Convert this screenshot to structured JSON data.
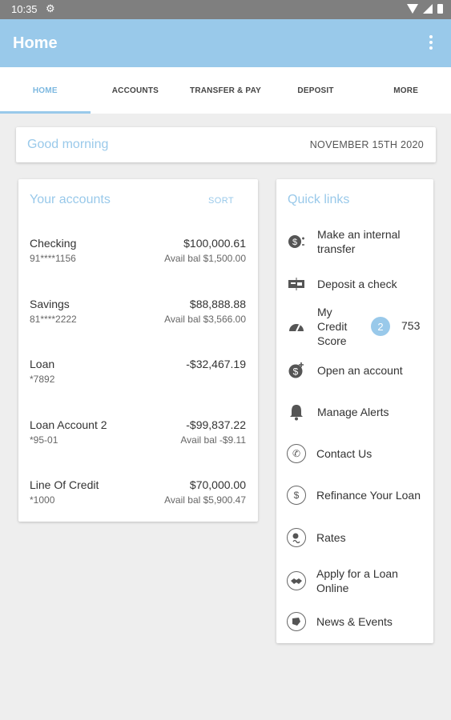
{
  "status_bar": {
    "time": "10:35"
  },
  "app_bar": {
    "title": "Home"
  },
  "tabs": [
    {
      "label": "HOME",
      "active": true
    },
    {
      "label": "ACCOUNTS",
      "active": false
    },
    {
      "label": "TRANSFER & PAY",
      "active": false
    },
    {
      "label": "DEPOSIT",
      "active": false
    },
    {
      "label": "MORE",
      "active": false
    }
  ],
  "greeting": {
    "text": "Good morning",
    "date": "NOVEMBER 15TH 2020"
  },
  "accounts": {
    "title": "Your accounts",
    "sort_label": "SORT",
    "items": [
      {
        "name": "Checking",
        "number": "91****1156",
        "amount": "$100,000.61",
        "avail": "Avail bal $1,500.00"
      },
      {
        "name": "Savings",
        "number": "81****2222",
        "amount": "$88,888.88",
        "avail": "Avail bal $3,566.00"
      },
      {
        "name": "Loan",
        "number": "*7892",
        "amount": "-$32,467.19",
        "avail": ""
      },
      {
        "name": "Loan Account 2",
        "number": "*95-01",
        "amount": "-$99,837.22",
        "avail": "Avail bal -$9.11"
      },
      {
        "name": "Line Of Credit",
        "number": "*1000",
        "amount": "$70,000.00",
        "avail": "Avail bal $5,900.47"
      }
    ]
  },
  "quick_links": {
    "title": "Quick links",
    "items": [
      {
        "label": "Make an internal transfer",
        "icon": "transfer-money-icon"
      },
      {
        "label": "Deposit a check",
        "icon": "check-deposit-icon"
      },
      {
        "label": "My Credit Score",
        "icon": "speedometer-icon",
        "badge": "2",
        "score": "753"
      },
      {
        "label": "Open an account",
        "icon": "add-money-icon"
      },
      {
        "label": "Manage Alerts",
        "icon": "bell-icon"
      },
      {
        "label": "Contact Us",
        "icon": "phone-icon"
      },
      {
        "label": "Refinance Your Loan",
        "icon": "dollar-circle-icon"
      },
      {
        "label": "Rates",
        "icon": "rates-icon"
      },
      {
        "label": "Apply for a Loan Online",
        "icon": "handshake-icon"
      },
      {
        "label": "News & Events",
        "icon": "news-icon"
      }
    ]
  },
  "colors": {
    "accent": "#99c9ea",
    "status_bar": "#7f7f7f",
    "background": "#eeeeee"
  }
}
